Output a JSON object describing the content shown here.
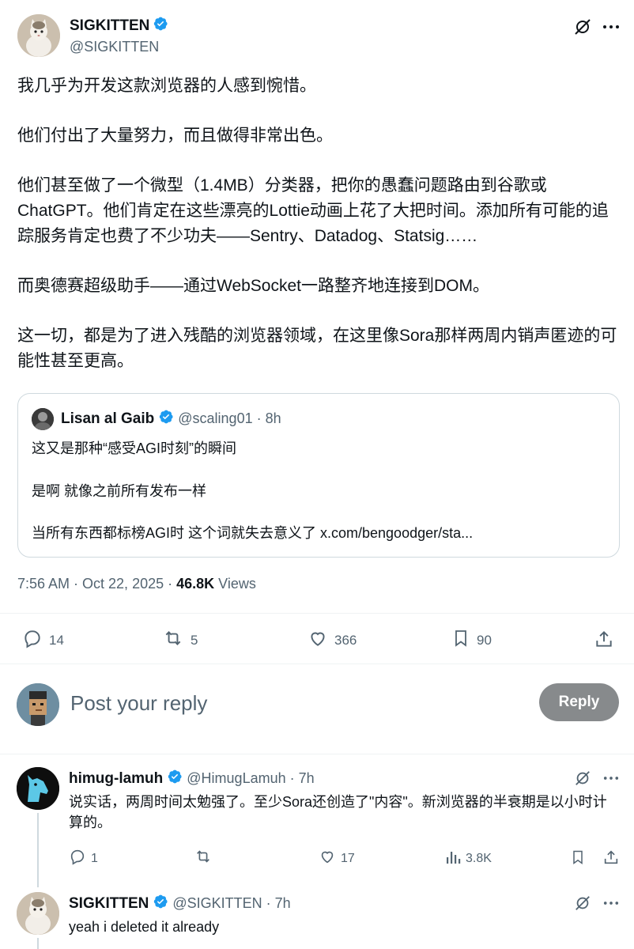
{
  "main_tweet": {
    "author_name": "SIGKITTEN",
    "author_handle": "@SIGKITTEN",
    "paragraphs": [
      "我几乎为开发这款浏览器的人感到惋惜。",
      "他们付出了大量努力，而且做得非常出色。",
      "他们甚至做了一个微型（1.4MB）分类器，把你的愚蠢问题路由到谷歌或ChatGPT。他们肯定在这些漂亮的Lottie动画上花了大把时间。添加所有可能的追踪服务肯定也费了不少功夫——Sentry、Datadog、Statsig……",
      "而奥德赛超级助手——通过WebSocket一路整齐地连接到DOM。",
      "这一切，都是为了进入残酷的浏览器领域，在这里像Sora那样两周内销声匿迹的可能性甚至更高。"
    ],
    "timestamp": "7:56 AM · Oct 22, 2025 · ",
    "views_count": "46.8K",
    "views_label": " Views",
    "stats": {
      "replies": "14",
      "reposts": "5",
      "likes": "366",
      "bookmarks": "90"
    }
  },
  "quote": {
    "author_name": "Lisan al Gaib",
    "author_handle": "@scaling01",
    "time": "· 8h",
    "lines": [
      "这又是那种“感受AGI时刻”的瞬间",
      "是啊 就像之前所有发布一样",
      "当所有东西都标榜AGI时 这个词就失去意义了 x.com/bengoodger/sta..."
    ]
  },
  "composer": {
    "placeholder": "Post your reply",
    "button_label": "Reply"
  },
  "replies": [
    {
      "author_name": "himug-lamuh",
      "author_handle": "@HimugLamuh",
      "time": "· 7h",
      "text": "说实话，两周时间太勉强了。至少Sora还创造了\"内容\"。新浏览器的半衰期是以小时计算的。",
      "stats": {
        "replies": "1",
        "reposts": "",
        "likes": "17",
        "views": "3.8K"
      }
    },
    {
      "author_name": "SIGKITTEN",
      "author_handle": "@SIGKITTEN",
      "time": "· 7h",
      "text": "yeah i deleted it already"
    }
  ],
  "colors": {
    "verified": "#1d9bf0",
    "text_primary": "#0f1419",
    "text_secondary": "#536471",
    "reply_button": "#878a8c",
    "border": "#cfd9de"
  },
  "icons": [
    "grok-icon",
    "more-icon",
    "reply-icon",
    "repost-icon",
    "like-icon",
    "bookmark-icon",
    "share-icon",
    "views-icon",
    "verified-icon"
  ]
}
